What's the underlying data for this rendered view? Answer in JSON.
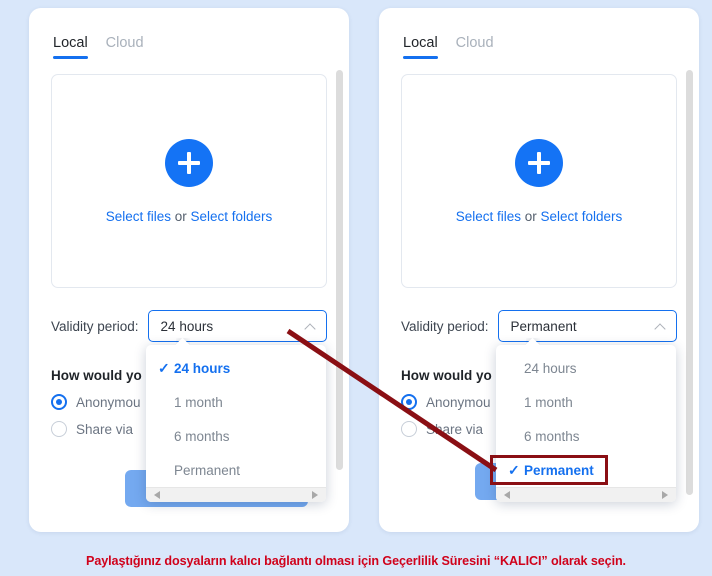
{
  "theme": {
    "background": "#d9e7fa",
    "card_background": "#ffffff",
    "accent_blue": "#1470ef",
    "muted_text": "#7d8691",
    "annotation_red": "#8a0f14",
    "caption_red": "#d0021b",
    "button_blue": "#74a9f0"
  },
  "panels": [
    {
      "id": "before",
      "tabs": [
        {
          "label": "Local",
          "active": true
        },
        {
          "label": "Cloud",
          "active": false
        }
      ],
      "dropzone": {
        "plus_icon": "plus-circle-icon",
        "select_files_label": "Select files",
        "or_label": " or ",
        "select_folders_label": "Select folders"
      },
      "validity": {
        "label": "Validity period:",
        "value": "24 hours",
        "caret_icon": "chevron-up-icon"
      },
      "share": {
        "heading": "How would yo",
        "options": [
          {
            "label": "Anonymou",
            "checked": true
          },
          {
            "label": "Share via ",
            "checked": false
          }
        ]
      },
      "primary_button": "",
      "dropdown": {
        "open": true,
        "options": [
          {
            "label": "24 hours",
            "selected": true
          },
          {
            "label": "1 month",
            "selected": false
          },
          {
            "label": "6 months",
            "selected": false
          },
          {
            "label": "Permanent",
            "selected": false
          }
        ],
        "scrollbar_left_icon": "scroll-left-arrow-icon",
        "scrollbar_right_icon": "scroll-right-arrow-icon"
      }
    },
    {
      "id": "after",
      "tabs": [
        {
          "label": "Local",
          "active": true
        },
        {
          "label": "Cloud",
          "active": false
        }
      ],
      "dropzone": {
        "plus_icon": "plus-circle-icon",
        "select_files_label": "Select files",
        "or_label": " or ",
        "select_folders_label": "Select folders"
      },
      "validity": {
        "label": "Validity period:",
        "value": "Permanent",
        "caret_icon": "chevron-up-icon"
      },
      "share": {
        "heading": "How would yo",
        "options": [
          {
            "label": "Anonymou",
            "checked": true
          },
          {
            "label": "Share via ",
            "checked": false
          }
        ]
      },
      "primary_button": "",
      "dropdown": {
        "open": true,
        "options": [
          {
            "label": "24 hours",
            "selected": false
          },
          {
            "label": "1 month",
            "selected": false
          },
          {
            "label": "6 months",
            "selected": false
          },
          {
            "label": "Permanent",
            "selected": true
          }
        ],
        "scrollbar_left_icon": "scroll-left-arrow-icon",
        "scrollbar_right_icon": "scroll-right-arrow-icon"
      }
    }
  ],
  "annotation": {
    "arrow_icon": "red-arrow-pointer",
    "highlight_target": "Permanent"
  },
  "caption": {
    "text": "Paylaştığınız dosyaların kalıcı bağlantı olması için Geçerlilik Süresini “KALICI” olarak seçin."
  }
}
